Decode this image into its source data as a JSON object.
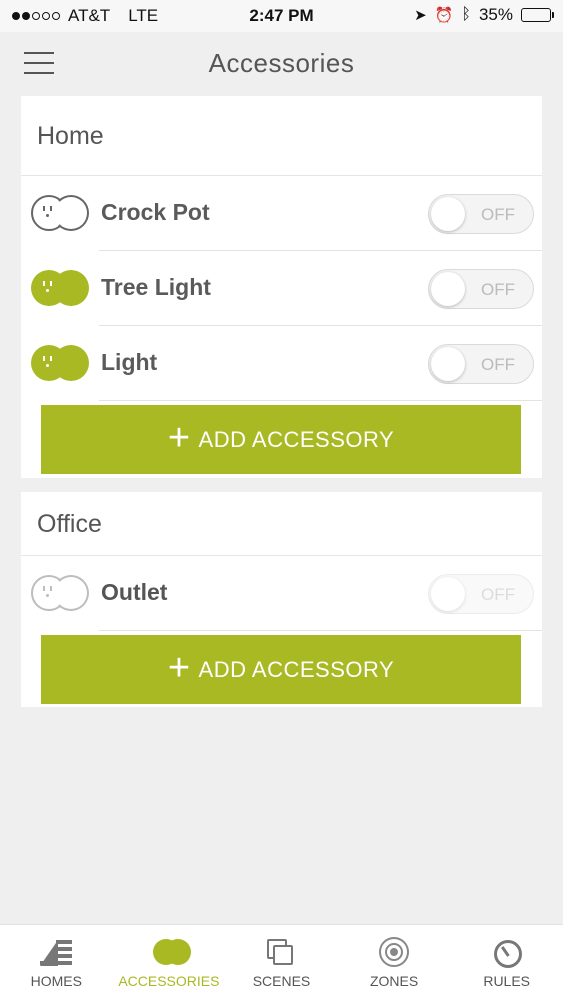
{
  "status_bar": {
    "carrier": "AT&T",
    "network": "LTE",
    "time": "2:47 PM",
    "battery": "35%",
    "battery_level": 0.35
  },
  "header": {
    "title": "Accessories"
  },
  "groups": [
    {
      "name": "Home",
      "accessories": [
        {
          "label": "Crock Pot",
          "state": "OFF",
          "icon": "outlet-icon"
        },
        {
          "label": "Tree Light",
          "state": "OFF",
          "icon": "outlet-icon"
        },
        {
          "label": "Light",
          "state": "OFF",
          "icon": "outlet-icon"
        }
      ],
      "add_label": "ADD ACCESSORY"
    },
    {
      "name": "Office",
      "accessories": [
        {
          "label": "Outlet",
          "state": "OFF",
          "icon": "outlet-icon"
        }
      ],
      "add_label": "ADD ACCESSORY"
    }
  ],
  "tabbar": {
    "tabs": [
      {
        "label": "HOMES",
        "icon": "homes-icon"
      },
      {
        "label": "ACCESSORIES",
        "icon": "accessories-icon",
        "active": true
      },
      {
        "label": "SCENES",
        "icon": "scenes-icon"
      },
      {
        "label": "ZONES",
        "icon": "zones-icon"
      },
      {
        "label": "RULES",
        "icon": "rules-icon"
      }
    ]
  },
  "colors": {
    "accent": "#a9b923",
    "background": "#efefef",
    "text": "#555555"
  }
}
